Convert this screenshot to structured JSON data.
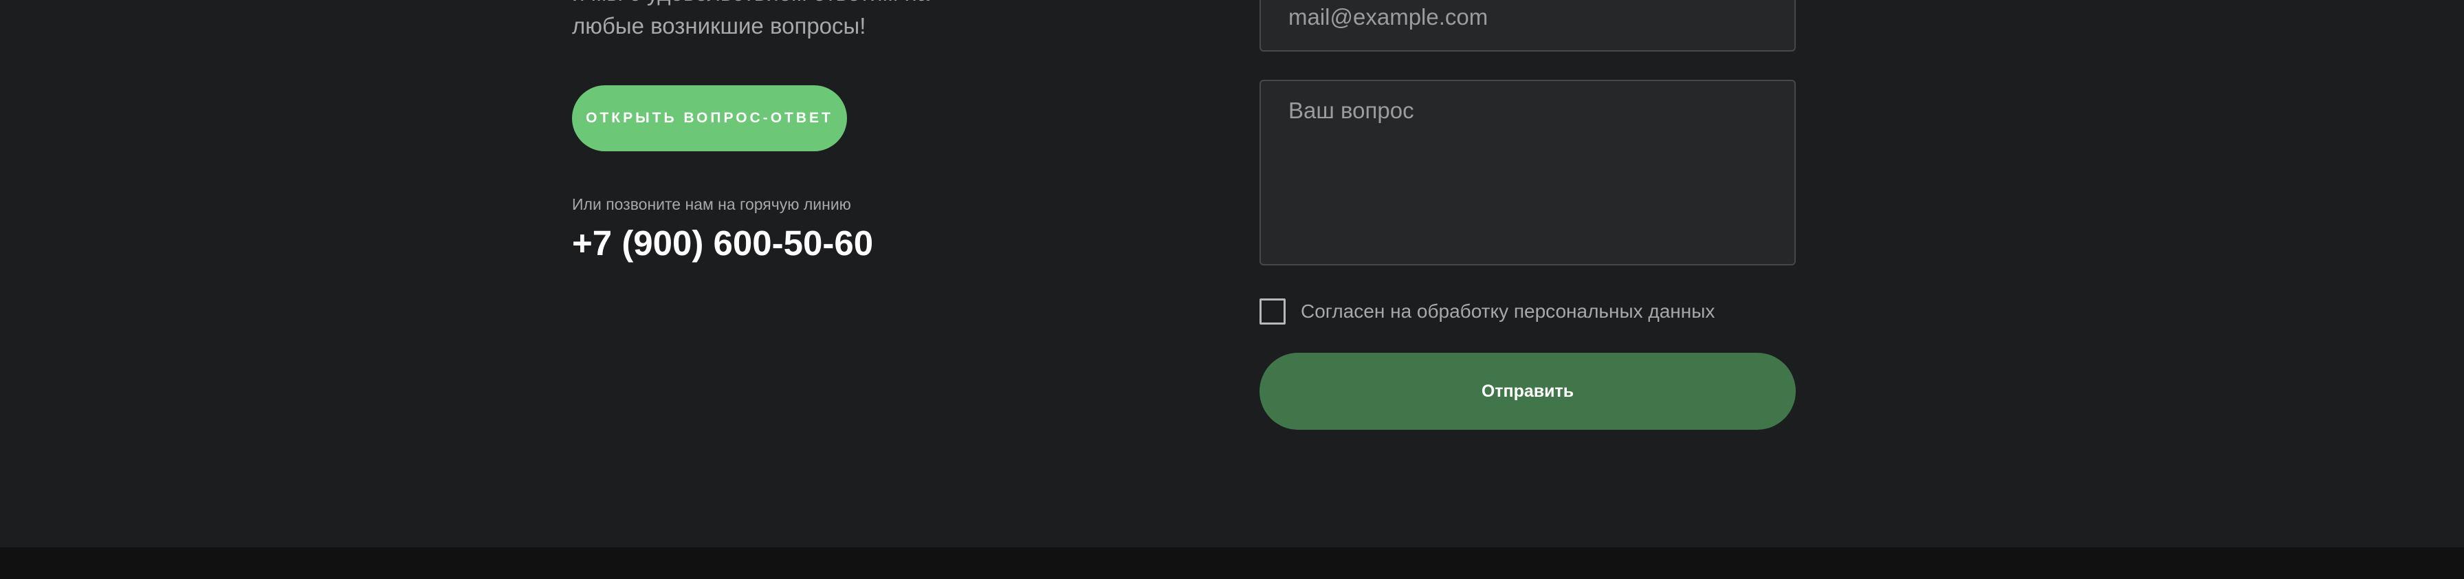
{
  "contact": {
    "intro_partial_line": "и мы с удовольствием ответим на",
    "intro_line": "любые возникшие вопросы!",
    "faq_button_label": "Открыть вопрос-ответ",
    "hotline_label": "Или позвоните нам на горячую линию",
    "hotline_phone": "+7 (900) 600-50-60"
  },
  "form": {
    "email_placeholder": "mail@example.com",
    "question_placeholder": "Ваш вопрос",
    "consent_label": "Согласен на обработку персональных данных",
    "consent_checked": false,
    "submit_label": "Отправить"
  },
  "colors": {
    "background": "#1c1d1f",
    "footer": "#111112",
    "accent_light": "#6cc776",
    "accent_dark": "#41764b",
    "field_background": "#262729",
    "field_border": "#47484b"
  }
}
